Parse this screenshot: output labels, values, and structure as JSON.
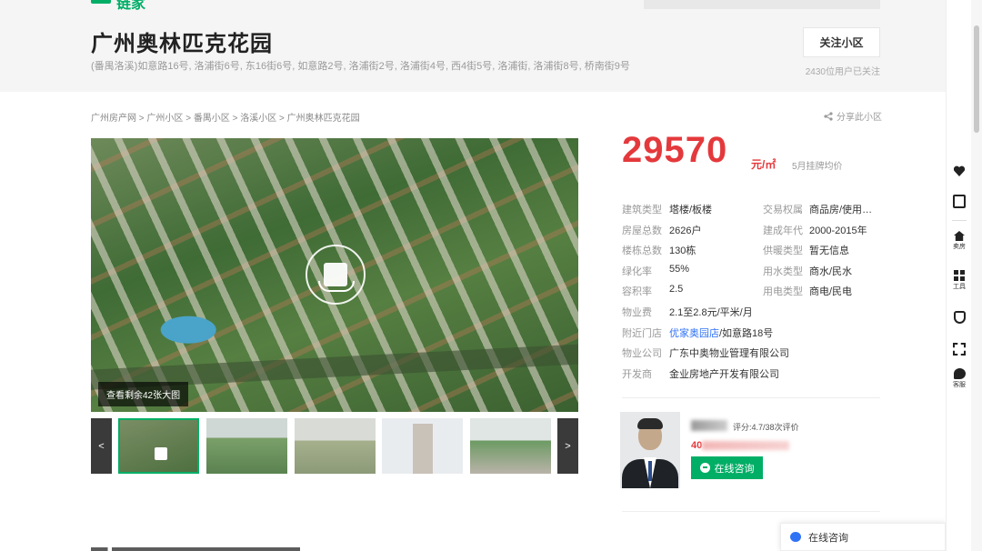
{
  "header": {
    "logo_text": "链家",
    "title": "广州奥林匹克花园",
    "address": "(番禺洛溪)如意路16号, 洛浦街6号, 东16街6号, 如意路2号, 洛浦街2号, 洛浦街4号, 西4街5号, 洛浦街, 洛浦街8号, 桥南街9号",
    "follow_label": "关注小区",
    "follow_count": "2430位用户已关注"
  },
  "breadcrumb": {
    "items": [
      "广州房产网",
      "广州小区",
      "番禺小区",
      "洛溪小区",
      "广州奥林匹克花园"
    ],
    "separator": ">",
    "share_label": "分享此小区"
  },
  "gallery": {
    "more_photos_label": "查看剩余42张大图",
    "prev_label": "<",
    "next_label": ">"
  },
  "price": {
    "value": "29570",
    "unit": "元/㎡",
    "note": "5月挂牌均价"
  },
  "info": {
    "rows": [
      {
        "k1": "建筑类型",
        "v1": "塔楼/板楼",
        "k2": "交易权属",
        "v2": "商品房/使用权…"
      },
      {
        "k1": "房屋总数",
        "v1": "2626户",
        "k2": "建成年代",
        "v2": "2000-2015年"
      },
      {
        "k1": "楼栋总数",
        "v1": "130栋",
        "k2": "供暖类型",
        "v2": "暂无信息"
      },
      {
        "k1": "绿化率",
        "v1": "55%",
        "k2": "用水类型",
        "v2": "商水/民水"
      },
      {
        "k1": "容积率",
        "v1": "2.5",
        "k2": "用电类型",
        "v2": "商电/民电"
      }
    ],
    "fee_label": "物业费",
    "fee_value": "2.1至2.8元/平米/月",
    "store_label": "附近门店",
    "store_link": "优家奥园店",
    "store_suffix": "/如意路18号",
    "company_label": "物业公司",
    "company_value": "广东中奥物业管理有限公司",
    "developer_label": "开发商",
    "developer_value": "金业房地产开发有限公司"
  },
  "agent": {
    "rating": "评分:4.7/38次评价",
    "phone_prefix": "40",
    "consult_label": "在线咨询"
  },
  "float_consult": {
    "label": "在线咨询"
  },
  "sidebar": {
    "sell_label": "卖房",
    "tool_label": "工具",
    "service_label": "客服"
  },
  "colors": {
    "brand_green": "#00ae66",
    "price_red": "#e4393c",
    "link_blue": "#3072f6"
  }
}
